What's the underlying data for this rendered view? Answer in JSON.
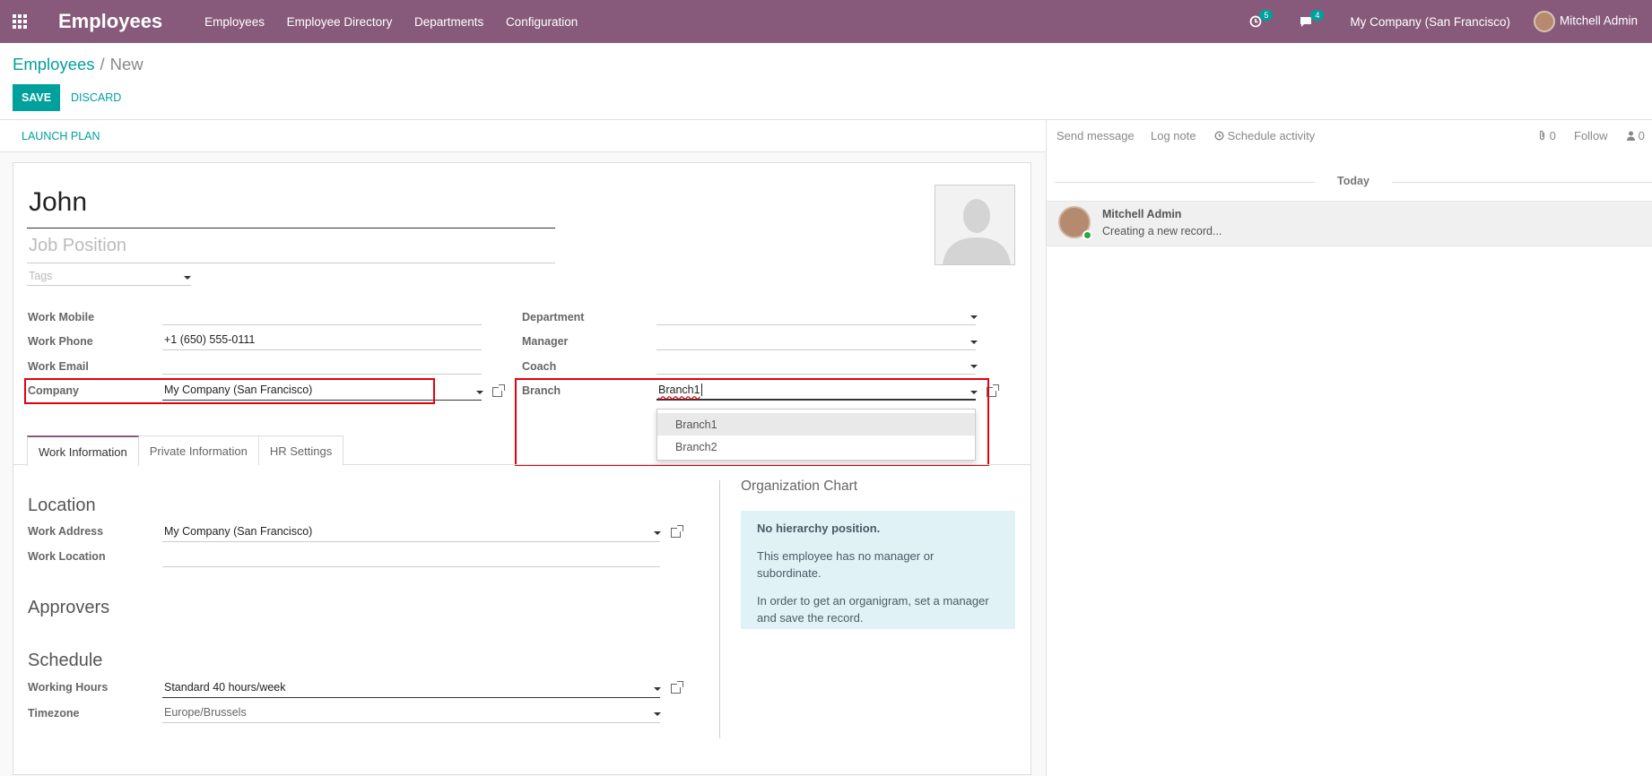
{
  "navbar": {
    "app_title": "Employees",
    "menu": [
      "Employees",
      "Employee Directory",
      "Departments",
      "Configuration"
    ],
    "activity_count": "5",
    "message_count": "4",
    "company": "My Company (San Francisco)",
    "user": "Mitchell Admin"
  },
  "breadcrumb": {
    "parent": "Employees",
    "separator": "/",
    "current": "New"
  },
  "buttons": {
    "save": "SAVE",
    "discard": "DISCARD",
    "launch_plan": "LAUNCH PLAN"
  },
  "form": {
    "name": "John",
    "job_position_placeholder": "Job Position",
    "tags_placeholder": "Tags",
    "left_fields": [
      {
        "label": "Work Mobile",
        "value": ""
      },
      {
        "label": "Work Phone",
        "value": "+1 (650) 555-0111"
      },
      {
        "label": "Work Email",
        "value": ""
      },
      {
        "label": "Company",
        "value": "My Company (San Francisco)"
      }
    ],
    "right_fields": [
      {
        "label": "Department",
        "value": ""
      },
      {
        "label": "Manager",
        "value": ""
      },
      {
        "label": "Coach",
        "value": ""
      },
      {
        "label": "Branch",
        "value": "Branch1"
      }
    ],
    "branch_options": [
      "Branch1",
      "Branch2"
    ]
  },
  "tabs": [
    "Work Information",
    "Private Information",
    "HR Settings"
  ],
  "work_info": {
    "location_title": "Location",
    "work_address_label": "Work Address",
    "work_address": "My Company (San Francisco)",
    "work_location_label": "Work Location",
    "work_location": "",
    "approvers_title": "Approvers",
    "schedule_title": "Schedule",
    "working_hours_label": "Working Hours",
    "working_hours": "Standard 40 hours/week",
    "timezone_label": "Timezone",
    "timezone": "Europe/Brussels"
  },
  "org_chart": {
    "title": "Organization Chart",
    "heading": "No hierarchy position.",
    "line1": "This employee has no manager or subordinate.",
    "line2": "In order to get an organigram, set a manager and save the record."
  },
  "chatter": {
    "send_message": "Send message",
    "log_note": "Log note",
    "schedule_activity": "Schedule activity",
    "attachments": "0",
    "follow": "Follow",
    "followers": "0",
    "date_separator": "Today",
    "message_author": "Mitchell Admin",
    "message_body": "Creating a new record..."
  }
}
